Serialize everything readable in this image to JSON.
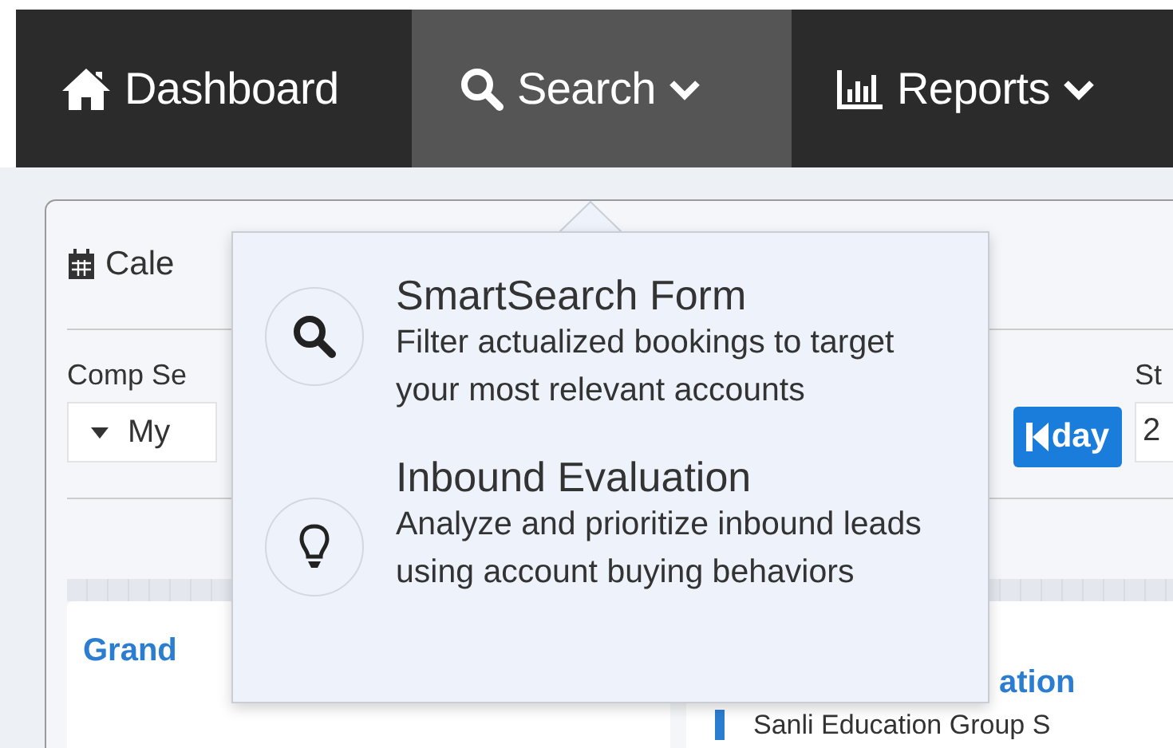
{
  "nav": [
    {
      "label": "Dashboard",
      "selected": false,
      "dropdown": false
    },
    {
      "label": "Search",
      "selected": true,
      "dropdown": true
    },
    {
      "label": "Reports",
      "selected": false,
      "dropdown": true
    }
  ],
  "panel": {
    "title": "Cale",
    "comp_label": "Comp Se",
    "comp_value": "My",
    "day_button": "day",
    "start_label": "St",
    "start_value": "2"
  },
  "cards": [
    {
      "title": "Grand"
    },
    {
      "title": "ation",
      "lines": [
        "Sanli Education Group S"
      ]
    }
  ],
  "menu": {
    "items": [
      {
        "title": "SmartSearch Form",
        "description": "Filter actualized bookings to target your most relevant accounts"
      },
      {
        "title": "Inbound Evaluation",
        "description": "Analyze and prioritize inbound leads using account buying behaviors"
      }
    ]
  }
}
